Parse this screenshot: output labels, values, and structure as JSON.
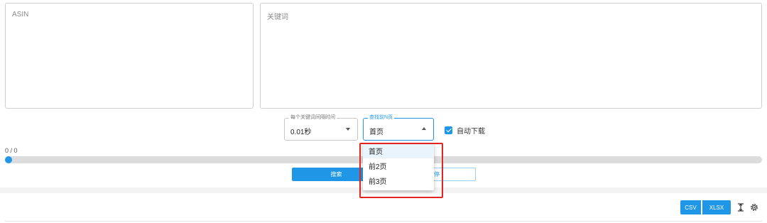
{
  "inputs": {
    "asin_placeholder": "ASIN",
    "keywords_placeholder": "关键词"
  },
  "controls": {
    "interval_label": "每个关键词间隔时间",
    "interval_value": "0.01秒",
    "pages_label": "查找前N页",
    "pages_value": "首页",
    "auto_download_label": "自动下载",
    "auto_download_checked": true
  },
  "progress": {
    "label": "0 / 0",
    "value": 0
  },
  "actions": {
    "search_label": "搜索",
    "secondary_label": "停"
  },
  "dropdown": {
    "options": [
      "首页",
      "前2页",
      "前3页"
    ],
    "selected_index": 0
  },
  "export": {
    "csv_label": "CSV",
    "xlsx_label": "XLSX"
  },
  "icons": {
    "columns": "column-height-icon",
    "settings": "gear-icon"
  },
  "colors": {
    "accent": "#1f97e6",
    "highlight": "#e2261f"
  }
}
